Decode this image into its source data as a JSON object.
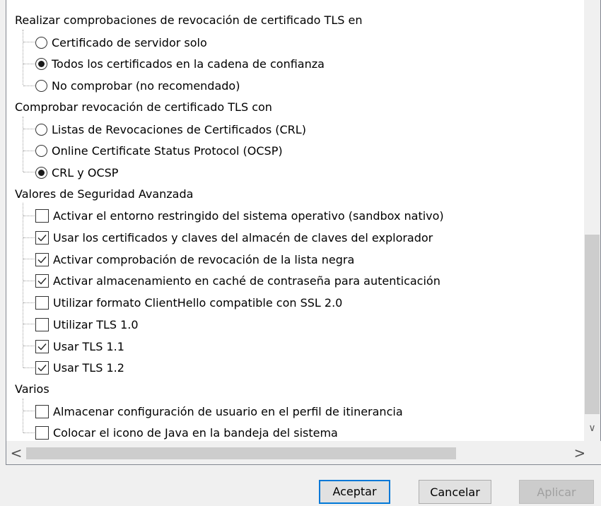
{
  "sections": [
    {
      "heading": "Realizar comprobaciones de revocación de certificado TLS en",
      "type": "radio",
      "options": [
        {
          "label": "Certificado de servidor solo",
          "checked": false
        },
        {
          "label": "Todos los certificados en la cadena de confianza",
          "checked": true
        },
        {
          "label": "No comprobar (no recomendado)",
          "checked": false
        }
      ]
    },
    {
      "heading": "Comprobar revocación de certificado TLS con",
      "type": "radio",
      "options": [
        {
          "label": "Listas de Revocaciones de Certificados (CRL)",
          "checked": false
        },
        {
          "label": "Online Certificate Status Protocol (OCSP)",
          "checked": false
        },
        {
          "label": "CRL y OCSP",
          "checked": true
        }
      ]
    },
    {
      "heading": "Valores de Seguridad Avanzada",
      "type": "checkbox",
      "options": [
        {
          "label": "Activar el entorno restringido del sistema operativo (sandbox nativo)",
          "checked": false
        },
        {
          "label": "Usar los certificados y claves del almacén de claves del explorador",
          "checked": true
        },
        {
          "label": "Activar comprobación de revocación de la lista negra",
          "checked": true
        },
        {
          "label": "Activar almacenamiento en caché de contraseña para autenticación",
          "checked": true
        },
        {
          "label": "Utilizar formato ClientHello compatible con SSL 2.0",
          "checked": false
        },
        {
          "label": "Utilizar TLS 1.0",
          "checked": false
        },
        {
          "label": "Usar TLS 1.1",
          "checked": true
        },
        {
          "label": "Usar TLS 1.2",
          "checked": true
        }
      ]
    },
    {
      "heading": "Varios",
      "type": "checkbox",
      "options": [
        {
          "label": "Almacenar configuración de usuario en el perfil de itinerancia",
          "checked": false
        },
        {
          "label": "Colocar el icono de Java en la bandeja del sistema",
          "checked": false
        }
      ]
    }
  ],
  "scroll": {
    "left_arrow": "<",
    "right_arrow": ">",
    "down_arrow": "∨"
  },
  "buttons": {
    "ok": "Aceptar",
    "cancel": "Cancelar",
    "apply": "Aplicar"
  }
}
